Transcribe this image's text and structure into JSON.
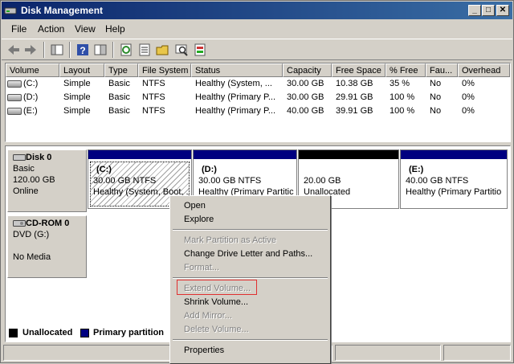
{
  "window": {
    "title": "Disk Management"
  },
  "titlebar_buttons": {
    "minimize": "_",
    "maximize": "□",
    "close": "✕"
  },
  "menubar": [
    "File",
    "Action",
    "View",
    "Help"
  ],
  "toolbar": {
    "icons": [
      "back-icon",
      "forward-icon",
      "console-tree-icon",
      "help-icon",
      "show-pane-icon",
      "refresh-icon",
      "properties-icon",
      "open-icon",
      "rescan-icon",
      "explore-icon"
    ]
  },
  "volume_list": {
    "columns": [
      "Volume",
      "Layout",
      "Type",
      "File System",
      "Status",
      "Capacity",
      "Free Space",
      "% Free",
      "Fau...",
      "Overhead"
    ],
    "rows": [
      [
        "(C:)",
        "Simple",
        "Basic",
        "NTFS",
        "Healthy (System, ...",
        "30.00 GB",
        "10.38 GB",
        "35 %",
        "No",
        "0%"
      ],
      [
        "(D:)",
        "Simple",
        "Basic",
        "NTFS",
        "Healthy (Primary P...",
        "30.00 GB",
        "29.91 GB",
        "100 %",
        "No",
        "0%"
      ],
      [
        "(E:)",
        "Simple",
        "Basic",
        "NTFS",
        "Healthy (Primary P...",
        "40.00 GB",
        "39.91 GB",
        "100 %",
        "No",
        "0%"
      ]
    ]
  },
  "disks": [
    {
      "name": "Disk 0",
      "type": "Basic",
      "size": "120.00 GB",
      "state": "Online",
      "partitions": [
        {
          "label": "(C:)",
          "size": "30.00 GB NTFS",
          "status": "Healthy (System, Boot, ...",
          "kind": "primary",
          "selected": true
        },
        {
          "label": "(D:)",
          "size": "30.00 GB NTFS",
          "status": "Healthy (Primary Partitic",
          "kind": "primary",
          "selected": false
        },
        {
          "label": "",
          "size": "20.00 GB",
          "status": "Unallocated",
          "kind": "unallocated",
          "selected": false
        },
        {
          "label": "(E:)",
          "size": "40.00 GB NTFS",
          "status": "Healthy (Primary Partitio",
          "kind": "primary",
          "selected": false
        }
      ]
    },
    {
      "name": "CD-ROM 0",
      "type": "DVD (G:)",
      "size": "",
      "state": "No Media"
    }
  ],
  "legend": {
    "unallocated": "Unallocated",
    "primary": "Primary partition"
  },
  "colors": {
    "primary": "#000080",
    "unallocated": "#000000",
    "highlight": "#e03030"
  },
  "context_menu": {
    "items": [
      {
        "label": "Open",
        "enabled": true
      },
      {
        "label": "Explore",
        "enabled": true
      },
      {
        "label": "Mark Partition as Active",
        "enabled": false
      },
      {
        "label": "Change Drive Letter and Paths...",
        "enabled": true
      },
      {
        "label": "Format...",
        "enabled": false
      },
      {
        "label": "Extend Volume...",
        "enabled": false
      },
      {
        "label": "Shrink Volume...",
        "enabled": true
      },
      {
        "label": "Add Mirror...",
        "enabled": false
      },
      {
        "label": "Delete Volume...",
        "enabled": false
      },
      {
        "label": "Properties",
        "enabled": true
      }
    ]
  }
}
